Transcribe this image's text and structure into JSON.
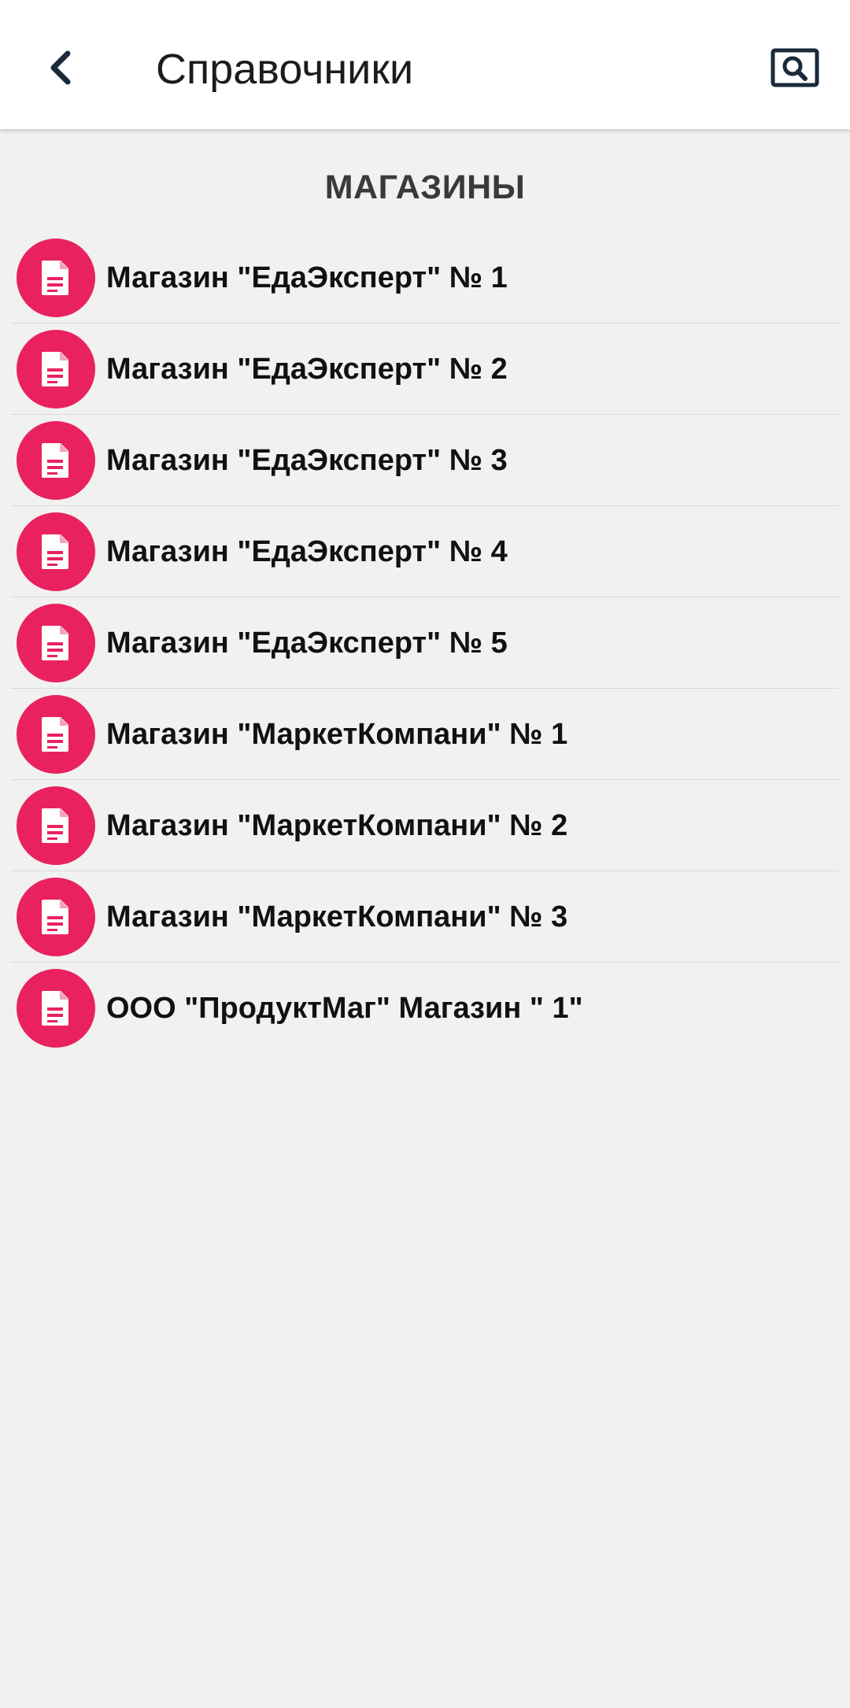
{
  "app_bar": {
    "title": "Справочники",
    "back_icon": "chevron-left-icon",
    "search_icon": "search-icon"
  },
  "section": {
    "title": "МАГАЗИНЫ"
  },
  "items": [
    {
      "label": "Магазин \"ЕдаЭксперт\" № 1",
      "icon": "document-icon"
    },
    {
      "label": "Магазин \"ЕдаЭксперт\" № 2",
      "icon": "document-icon"
    },
    {
      "label": "Магазин \"ЕдаЭксперт\" № 3",
      "icon": "document-icon"
    },
    {
      "label": "Магазин \"ЕдаЭксперт\" № 4",
      "icon": "document-icon"
    },
    {
      "label": "Магазин \"ЕдаЭксперт\" № 5",
      "icon": "document-icon"
    },
    {
      "label": "Магазин \"МаркетКомпани\" № 1",
      "icon": "document-icon"
    },
    {
      "label": "Магазин \"МаркетКомпани\" № 2",
      "icon": "document-icon"
    },
    {
      "label": "Магазин \"МаркетКомпани\" № 3",
      "icon": "document-icon"
    },
    {
      "label": "ООО \"ПродуктМаг\" Магазин \" 1\"",
      "icon": "document-icon"
    }
  ],
  "colors": {
    "accent": "#e9225f",
    "app_bar_icon": "#1b2a3a",
    "background": "#f1f1f1"
  }
}
